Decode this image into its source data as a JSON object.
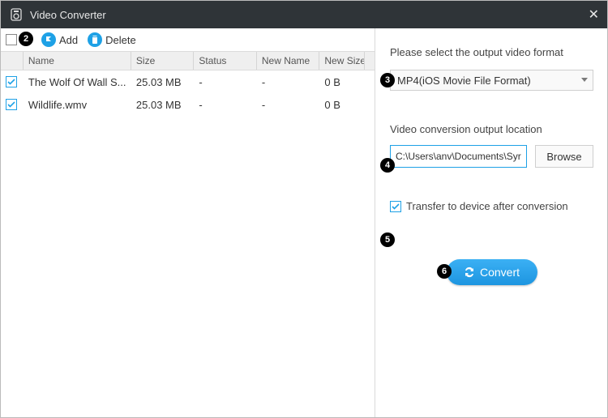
{
  "title": "Video Converter",
  "toolbar": {
    "add_label": "Add",
    "delete_label": "Delete"
  },
  "columns": {
    "name": "Name",
    "size": "Size",
    "status": "Status",
    "newname": "New Name",
    "newsize": "New Size"
  },
  "rows": [
    {
      "checked": true,
      "name": "The Wolf Of Wall S...",
      "size": "25.03 MB",
      "status": "-",
      "newname": "-",
      "newsize": "0 B"
    },
    {
      "checked": true,
      "name": "Wildlife.wmv",
      "size": "25.03 MB",
      "status": "-",
      "newname": "-",
      "newsize": "0 B"
    }
  ],
  "right": {
    "format_label": "Please select the output video format",
    "format_value": "MP4(iOS Movie File Format)",
    "location_label": "Video conversion output location",
    "location_value": "C:\\Users\\anv\\Documents\\Syr",
    "browse_label": "Browse",
    "transfer_label": "Transfer to device after conversion",
    "transfer_checked": true,
    "convert_label": "Convert"
  },
  "annotations": [
    "2",
    "3",
    "4",
    "5",
    "6"
  ]
}
